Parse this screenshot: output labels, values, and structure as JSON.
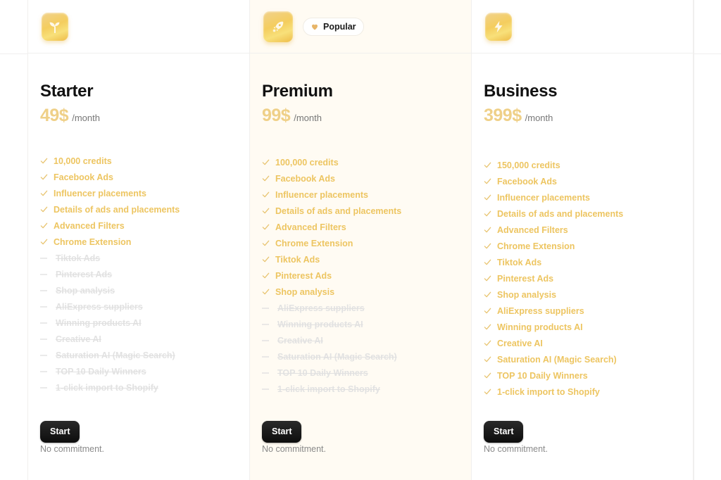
{
  "colors": {
    "accent": "#edc561",
    "price": "#efd088",
    "disabled": "#e2e2e2",
    "highlight_bg": "#fffbf3",
    "button_bg": "#111111"
  },
  "plans": [
    {
      "name": "Starter",
      "icon": "sprout-icon",
      "price": "49$",
      "period": "/month",
      "badge": null,
      "cta_label": "Start",
      "note": "No commitment.",
      "features": [
        {
          "label": "10,000 credits",
          "included": true
        },
        {
          "label": "Facebook Ads",
          "included": true
        },
        {
          "label": "Influencer placements",
          "included": true
        },
        {
          "label": "Details of ads and placements",
          "included": true
        },
        {
          "label": "Advanced Filters",
          "included": true
        },
        {
          "label": "Chrome Extension",
          "included": true
        },
        {
          "label": "Tiktok Ads",
          "included": false
        },
        {
          "label": "Pinterest Ads",
          "included": false
        },
        {
          "label": "Shop analysis",
          "included": false
        },
        {
          "label": "AliExpress suppliers",
          "included": false
        },
        {
          "label": "Winning products AI",
          "included": false
        },
        {
          "label": "Creative AI",
          "included": false
        },
        {
          "label": "Saturation AI (Magic Search)",
          "included": false
        },
        {
          "label": "TOP 10 Daily Winners",
          "included": false
        },
        {
          "label": "1-click import to Shopify",
          "included": false
        }
      ]
    },
    {
      "name": "Premium",
      "icon": "rocket-icon",
      "price": "99$",
      "period": "/month",
      "badge": {
        "label": "Popular",
        "icon": "heart-icon"
      },
      "cta_label": "Start",
      "note": "No commitment.",
      "features": [
        {
          "label": "100,000 credits",
          "included": true
        },
        {
          "label": "Facebook Ads",
          "included": true
        },
        {
          "label": "Influencer placements",
          "included": true
        },
        {
          "label": "Details of ads and placements",
          "included": true
        },
        {
          "label": "Advanced Filters",
          "included": true
        },
        {
          "label": "Chrome Extension",
          "included": true
        },
        {
          "label": "Tiktok Ads",
          "included": true
        },
        {
          "label": "Pinterest Ads",
          "included": true
        },
        {
          "label": "Shop analysis",
          "included": true
        },
        {
          "label": "AliExpress suppliers",
          "included": false
        },
        {
          "label": "Winning products AI",
          "included": false
        },
        {
          "label": "Creative AI",
          "included": false
        },
        {
          "label": "Saturation AI (Magic Search)",
          "included": false
        },
        {
          "label": "TOP 10 Daily Winners",
          "included": false
        },
        {
          "label": "1-click import to Shopify",
          "included": false
        }
      ]
    },
    {
      "name": "Business",
      "icon": "lightning-icon",
      "price": "399$",
      "period": "/month",
      "badge": null,
      "cta_label": "Start",
      "note": "No commitment.",
      "features": [
        {
          "label": "150,000 credits",
          "included": true
        },
        {
          "label": "Facebook Ads",
          "included": true
        },
        {
          "label": "Influencer placements",
          "included": true
        },
        {
          "label": "Details of ads and placements",
          "included": true
        },
        {
          "label": "Advanced Filters",
          "included": true
        },
        {
          "label": "Chrome Extension",
          "included": true
        },
        {
          "label": "Tiktok Ads",
          "included": true
        },
        {
          "label": "Pinterest Ads",
          "included": true
        },
        {
          "label": "Shop analysis",
          "included": true
        },
        {
          "label": "AliExpress suppliers",
          "included": true
        },
        {
          "label": "Winning products AI",
          "included": true
        },
        {
          "label": "Creative AI",
          "included": true
        },
        {
          "label": "Saturation AI (Magic Search)",
          "included": true
        },
        {
          "label": "TOP 10 Daily Winners",
          "included": true
        },
        {
          "label": "1-click import to Shopify",
          "included": true
        }
      ]
    }
  ]
}
